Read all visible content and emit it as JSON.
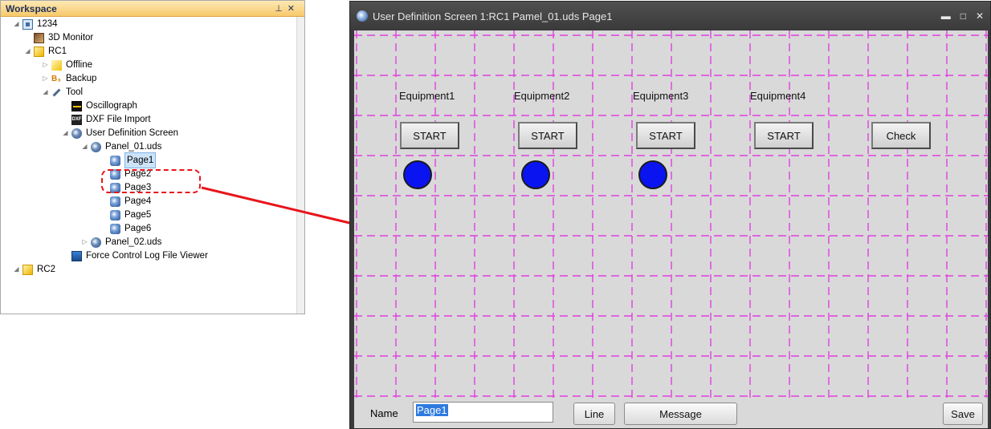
{
  "workspace": {
    "title": "Workspace",
    "pin_icon": "pin-icon",
    "close_icon": "close-icon",
    "tree": [
      {
        "label": "1234",
        "icon": "computer-icon"
      },
      {
        "label": "3D Monitor",
        "icon": "monitor-icon"
      },
      {
        "label": "RC1",
        "icon": "controller-icon"
      },
      {
        "label": "Offline",
        "icon": "offline-icon"
      },
      {
        "label": "Backup",
        "icon": "backup-icon"
      },
      {
        "label": "Tool",
        "icon": "tool-icon"
      },
      {
        "label": "Oscillograph",
        "icon": "oscillograph-icon"
      },
      {
        "label": "DXF File Import",
        "icon": "dxf-icon"
      },
      {
        "label": "User Definition Screen",
        "icon": "user-definition-icon"
      },
      {
        "label": "Panel_01.uds",
        "icon": "uds-file-icon"
      },
      {
        "label": "Page1",
        "icon": "page-icon",
        "selected": true
      },
      {
        "label": "Page2",
        "icon": "page-icon"
      },
      {
        "label": "Page3",
        "icon": "page-icon"
      },
      {
        "label": "Page4",
        "icon": "page-icon"
      },
      {
        "label": "Page5",
        "icon": "page-icon"
      },
      {
        "label": "Page6",
        "icon": "page-icon"
      },
      {
        "label": "Panel_02.uds",
        "icon": "uds-file-icon"
      },
      {
        "label": "Force Control Log File Viewer",
        "icon": "force-log-icon"
      },
      {
        "label": "RC2",
        "icon": "controller-icon"
      }
    ]
  },
  "window": {
    "title": "User Definition Screen 1:RC1 Pamel_01.uds Page1",
    "controls": [
      "minimize-icon",
      "maximize-icon",
      "close-icon"
    ],
    "equipment_labels": [
      "Equipment1",
      "Equipment2",
      "Equipment3",
      "Equipment4"
    ],
    "start_buttons": [
      "START",
      "START",
      "START",
      "START"
    ],
    "check_button": "Check",
    "lamp_color": "#0a14f0",
    "grid_color": "#e040e0",
    "bottom": {
      "name_label": "Name",
      "name_value": "Page1",
      "line_button": "Line",
      "message_button": "Message",
      "save_button": "Save"
    }
  },
  "colors": {
    "callout": "#e8141b",
    "panel_header": "#f7c96a",
    "titlebar": "#3a3a3a"
  }
}
